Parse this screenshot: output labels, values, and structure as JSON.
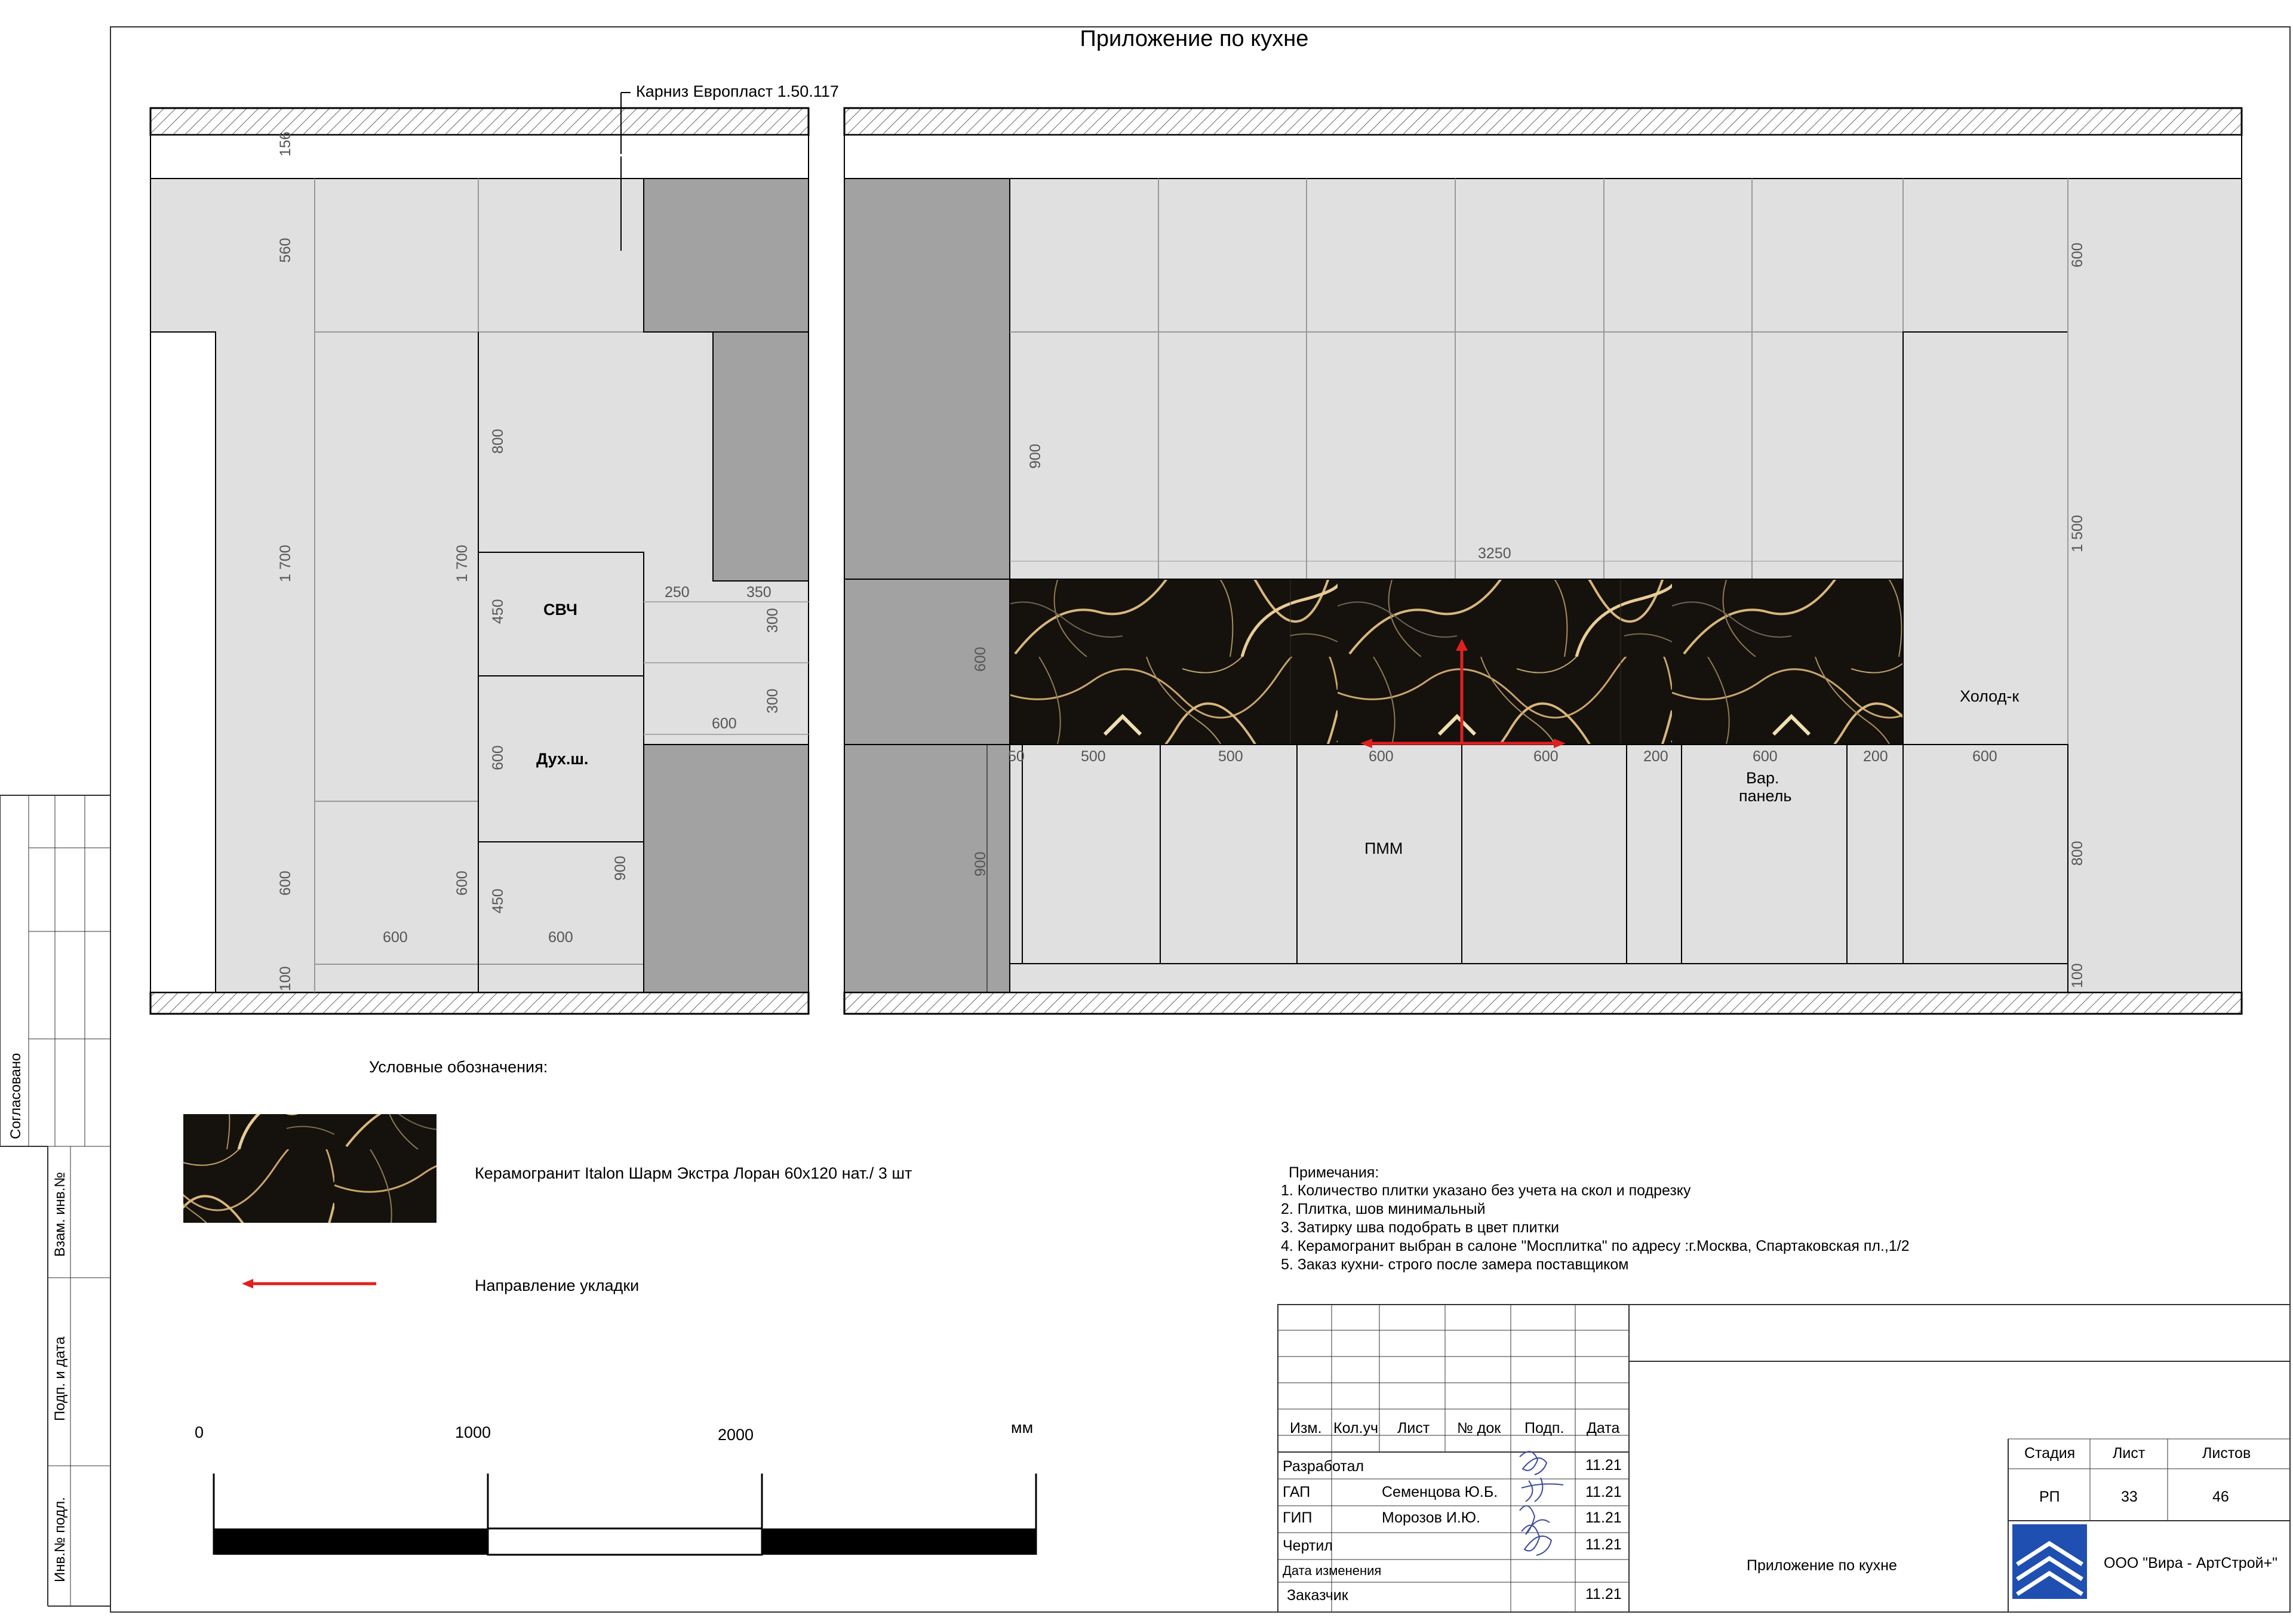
{
  "sheet_title": "Приложение по кухне",
  "cornice_label": "Карниз Европласт 1.50.117",
  "colors": {
    "dark_panel": "#a2a2a2",
    "light_panel": "#e0e0e0",
    "marble_base": "#15110c",
    "marble_vein": "#c9a56a",
    "arrow": "#e02020",
    "note_red": "#e02020"
  },
  "left_elevation": {
    "labels": {
      "microwave": "СВЧ",
      "oven": "Дух.ш."
    },
    "dims": {
      "d156": "156",
      "d560": "560",
      "d1700a": "1 700",
      "d1700b": "1 700",
      "d600a": "600",
      "d600b": "600",
      "d100": "100",
      "d800": "800",
      "d450a": "450",
      "d600c": "600",
      "d450b": "450",
      "d250": "250",
      "d350": "350",
      "d300a": "300",
      "d300b": "300",
      "d600d": "600",
      "d900": "900",
      "d600e": "600",
      "d600f": "600"
    }
  },
  "right_elevation": {
    "labels": {
      "fridge": "Холод-к",
      "dishwasher": "ПММ",
      "cooktop_l1": "Вар.",
      "cooktop_l2": "панель"
    },
    "dims": {
      "d3250": "3250",
      "d900a": "900",
      "d600a": "600",
      "d900b": "900",
      "d600r1": "600",
      "d1500": "1 500",
      "d800": "800",
      "d100": "100",
      "b50": "50",
      "b500a": "500",
      "b500b": "500",
      "b600a": "600",
      "b600b": "600",
      "b200a": "200",
      "b600c": "600",
      "b200b": "200",
      "b600d": "600"
    }
  },
  "legend": {
    "title": "Условные обозначения:",
    "tile_label": "Керамогранит Italon Шарм Экстра Лоран 60х120 нат./ 3 шт",
    "arrow_label": "Направление укладки"
  },
  "scale_bar": {
    "t0": "0",
    "t1000": "1000",
    "t2000": "2000",
    "unit": "мм"
  },
  "notes": {
    "heading": "Примечания:",
    "items": [
      "1. Количество плитки указано без учета на скол и подрезку",
      "2. Плитка, шов минимальный",
      "3. Затирку шва подобрать в цвет плитки",
      "4. Керамогранит выбран в салоне \"Мосплитка\" по адресу :г.Москва, Спартаковская пл.,1/2"
    ],
    "warning": "5. Заказ кухни- строго после замера поставщиком"
  },
  "side_stamp": {
    "agreed": "Согласовано",
    "replace_inv": "Взам. инв.№",
    "sign_date": "Подп. и дата",
    "inv_orig": "Инв.№ подл."
  },
  "title_block": {
    "headers": {
      "izm": "Изм.",
      "kolvo": "Кол.уч",
      "list": "Лист",
      "ndoc": "№ док",
      "podp": "Подп.",
      "date": "Дата"
    },
    "rows": [
      {
        "role": "Разработал",
        "name": "",
        "date": "11.21"
      },
      {
        "role": "ГАП",
        "name": "Семенцова Ю.Б.",
        "date": "11.21"
      },
      {
        "role": "ГИП",
        "name": "Морозов И.Ю.",
        "date": "11.21"
      },
      {
        "role": "Чертил",
        "name": "",
        "date": "11.21"
      },
      {
        "role": "Дата изменения",
        "name": "",
        "date": ""
      },
      {
        "role": "Заказчик",
        "name": "",
        "date": "11.21"
      }
    ],
    "doc_title": "Приложение по кухне",
    "stage_header": "Стадия",
    "sheet_header": "Лист",
    "sheets_header": "Листов",
    "stage": "РП",
    "sheet": "33",
    "sheets": "46",
    "company": "ООО \"Вира - АртСтрой+\""
  }
}
